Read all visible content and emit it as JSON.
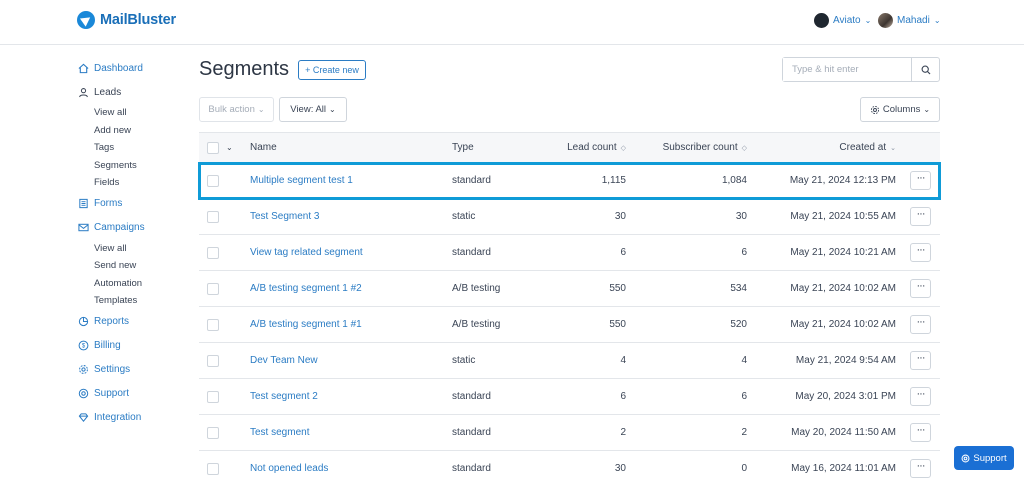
{
  "app": {
    "name": "MailBluster"
  },
  "topbar": {
    "org": {
      "name": "Aviato"
    },
    "user": {
      "name": "Mahadi"
    }
  },
  "sidebar": {
    "dashboard": "Dashboard",
    "leads": {
      "label": "Leads",
      "sub": [
        "View all",
        "Add new",
        "Tags",
        "Segments",
        "Fields"
      ]
    },
    "forms": "Forms",
    "campaigns": {
      "label": "Campaigns",
      "sub": [
        "View all",
        "Send new",
        "Automation",
        "Templates"
      ]
    },
    "reports": "Reports",
    "billing": "Billing",
    "settings": "Settings",
    "support": "Support",
    "integration": "Integration"
  },
  "page": {
    "title": "Segments",
    "create_label": "+ Create new",
    "search_placeholder": "Type & hit enter",
    "bulk_label": "Bulk action",
    "view_label": "View: All",
    "columns_label": "Columns"
  },
  "table": {
    "headers": {
      "name": "Name",
      "type": "Type",
      "lead": "Lead count",
      "subscriber": "Subscriber count",
      "created": "Created at"
    },
    "rows": [
      {
        "name": "Multiple segment test 1",
        "type": "standard",
        "lead": "1,115",
        "subscriber": "1,084",
        "created": "May 21, 2024 12:13 PM",
        "highlight": true
      },
      {
        "name": "Test Segment 3",
        "type": "static",
        "lead": "30",
        "subscriber": "30",
        "created": "May 21, 2024 10:55 AM"
      },
      {
        "name": "View tag related segment",
        "type": "standard",
        "lead": "6",
        "subscriber": "6",
        "created": "May 21, 2024 10:21 AM"
      },
      {
        "name": "A/B testing segment 1 #2",
        "type": "A/B testing",
        "lead": "550",
        "subscriber": "534",
        "created": "May 21, 2024 10:02 AM"
      },
      {
        "name": "A/B testing segment 1 #1",
        "type": "A/B testing",
        "lead": "550",
        "subscriber": "520",
        "created": "May 21, 2024 10:02 AM"
      },
      {
        "name": "Dev Team New",
        "type": "static",
        "lead": "4",
        "subscriber": "4",
        "created": "May 21, 2024 9:54 AM"
      },
      {
        "name": "Test segment 2",
        "type": "standard",
        "lead": "6",
        "subscriber": "6",
        "created": "May 20, 2024 3:01 PM"
      },
      {
        "name": "Test segment",
        "type": "standard",
        "lead": "2",
        "subscriber": "2",
        "created": "May 20, 2024 11:50 AM"
      },
      {
        "name": "Not opened leads",
        "type": "standard",
        "lead": "30",
        "subscriber": "0",
        "created": "May 16, 2024 11:01 AM"
      }
    ]
  },
  "support_widget": {
    "label": "Support"
  },
  "colors": {
    "accent": "#2b7cc4",
    "highlight": "#0f9bd7",
    "support": "#1a6fd4"
  }
}
